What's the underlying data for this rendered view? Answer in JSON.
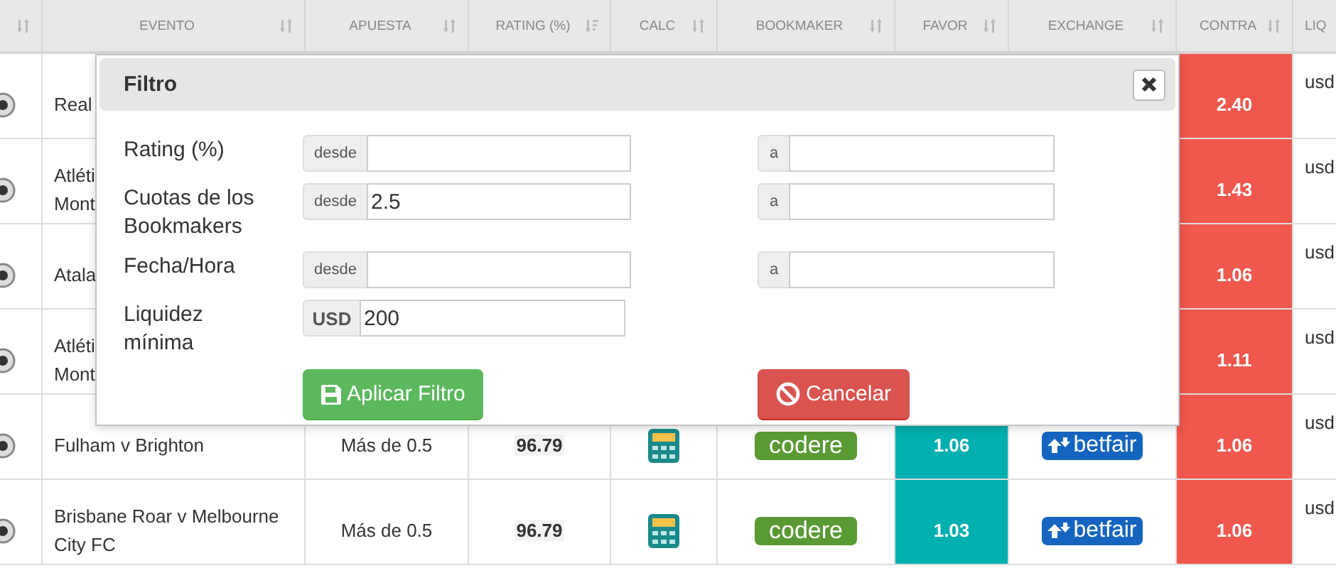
{
  "table": {
    "columns": [
      {
        "sortable": true,
        "sorted": false
      },
      {
        "label": "EVENTO",
        "sortable": true,
        "sorted": false
      },
      {
        "label": "APUESTA",
        "sortable": true,
        "sorted": false
      },
      {
        "label": "RATING (%)",
        "sortable": true,
        "sorted": true
      },
      {
        "label": "CALC",
        "sortable": true,
        "sorted": false
      },
      {
        "label": "BOOKMAKER",
        "sortable": true,
        "sorted": false
      },
      {
        "label": "FAVOR",
        "sortable": true,
        "sorted": false
      },
      {
        "label": "EXCHANGE",
        "sortable": true,
        "sorted": false
      },
      {
        "label": "CONTRA",
        "sortable": true,
        "sorted": false
      },
      {
        "label": "LIQ",
        "sortable": false,
        "sorted": false
      }
    ],
    "rows": [
      {
        "event": "Real",
        "contra": "2.40",
        "liquidity": "usd"
      },
      {
        "event": "Atléti\nMont",
        "contra": "1.43",
        "liquidity": "usd"
      },
      {
        "event": "Atala",
        "contra": "1.06",
        "liquidity": "usd"
      },
      {
        "event": "Atléti\nMont",
        "contra": "1.11",
        "liquidity": "usd"
      },
      {
        "event": "Fulham v Brighton",
        "bet": "Más de 0.5",
        "rating": "96.79",
        "bookmaker": "codere",
        "favor": "1.06",
        "exchange": "betfair",
        "contra": "1.06",
        "liquidity": "usd"
      },
      {
        "event": "Brisbane Roar v Melbourne City FC",
        "bet": "Más de 0.5",
        "rating": "96.79",
        "bookmaker": "codere",
        "favor": "1.03",
        "exchange": "betfair",
        "contra": "1.06",
        "liquidity": "usd"
      }
    ]
  },
  "filter_modal": {
    "title": "Filtro",
    "fields": [
      {
        "kind": "range",
        "label": "Rating (%)",
        "from_addon": "desde",
        "to_addon": "a"
      },
      {
        "kind": "range",
        "label": "Cuotas de los Bookmakers",
        "from_addon": "desde",
        "from_value": "2.5",
        "to_addon": "a"
      },
      {
        "kind": "range",
        "label": "Fecha/Hora",
        "from_addon": "desde",
        "to_addon": "a"
      },
      {
        "kind": "single",
        "label": "Liquidez mínima",
        "addon": "USD",
        "value": "200"
      }
    ],
    "buttons": [
      {
        "label": "Aplicar Filtro",
        "kind": "success"
      },
      {
        "label": "Cancelar",
        "kind": "danger"
      }
    ]
  }
}
